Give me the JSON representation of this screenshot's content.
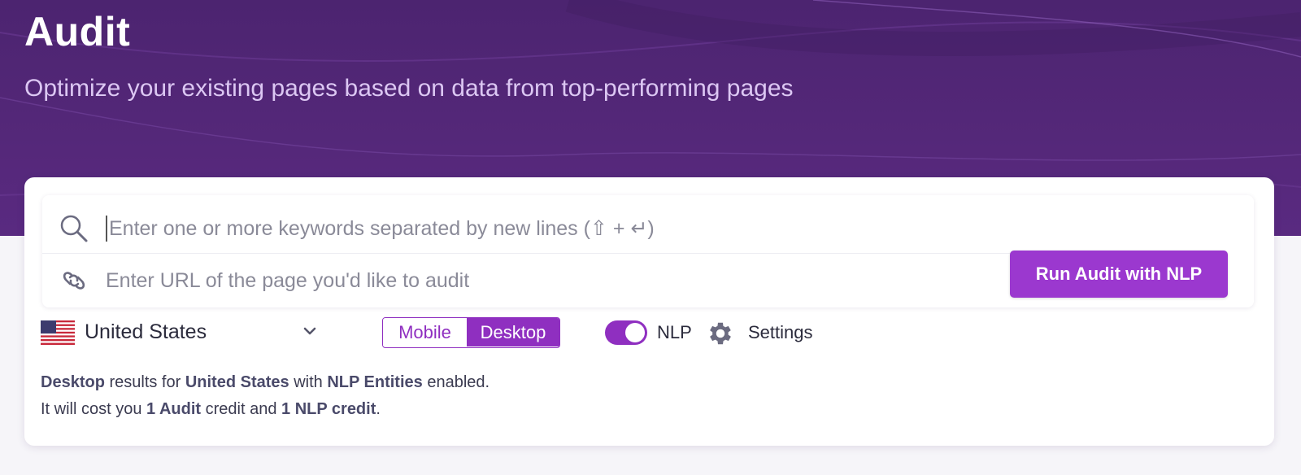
{
  "header": {
    "title": "Audit",
    "subtitle": "Optimize your existing pages based on data from top-performing pages"
  },
  "search": {
    "keywords_placeholder": "Enter one or more keywords separated by new lines (⇧ + ↵)",
    "url_placeholder": "Enter URL of the page you'd like to audit",
    "run_button_label": "Run Audit with NLP"
  },
  "options": {
    "country": "United States",
    "device_options": [
      "Mobile",
      "Desktop"
    ],
    "device_selected": "Desktop",
    "nlp_label": "NLP",
    "nlp_enabled": true,
    "settings_label": "Settings"
  },
  "summary": {
    "line1": {
      "device": "Desktop",
      "t1": " results for ",
      "country": "United States",
      "t2": " with ",
      "feature": "NLP Entities",
      "t3": " enabled."
    },
    "line2": {
      "t1": "It will cost you ",
      "credit1": "1 Audit",
      "t2": " credit and ",
      "credit2": "1 NLP credit",
      "t3": "."
    }
  },
  "colors": {
    "accent": "#9b38cf",
    "hero": "#55287a",
    "subtitle": "#dcc7f3"
  }
}
